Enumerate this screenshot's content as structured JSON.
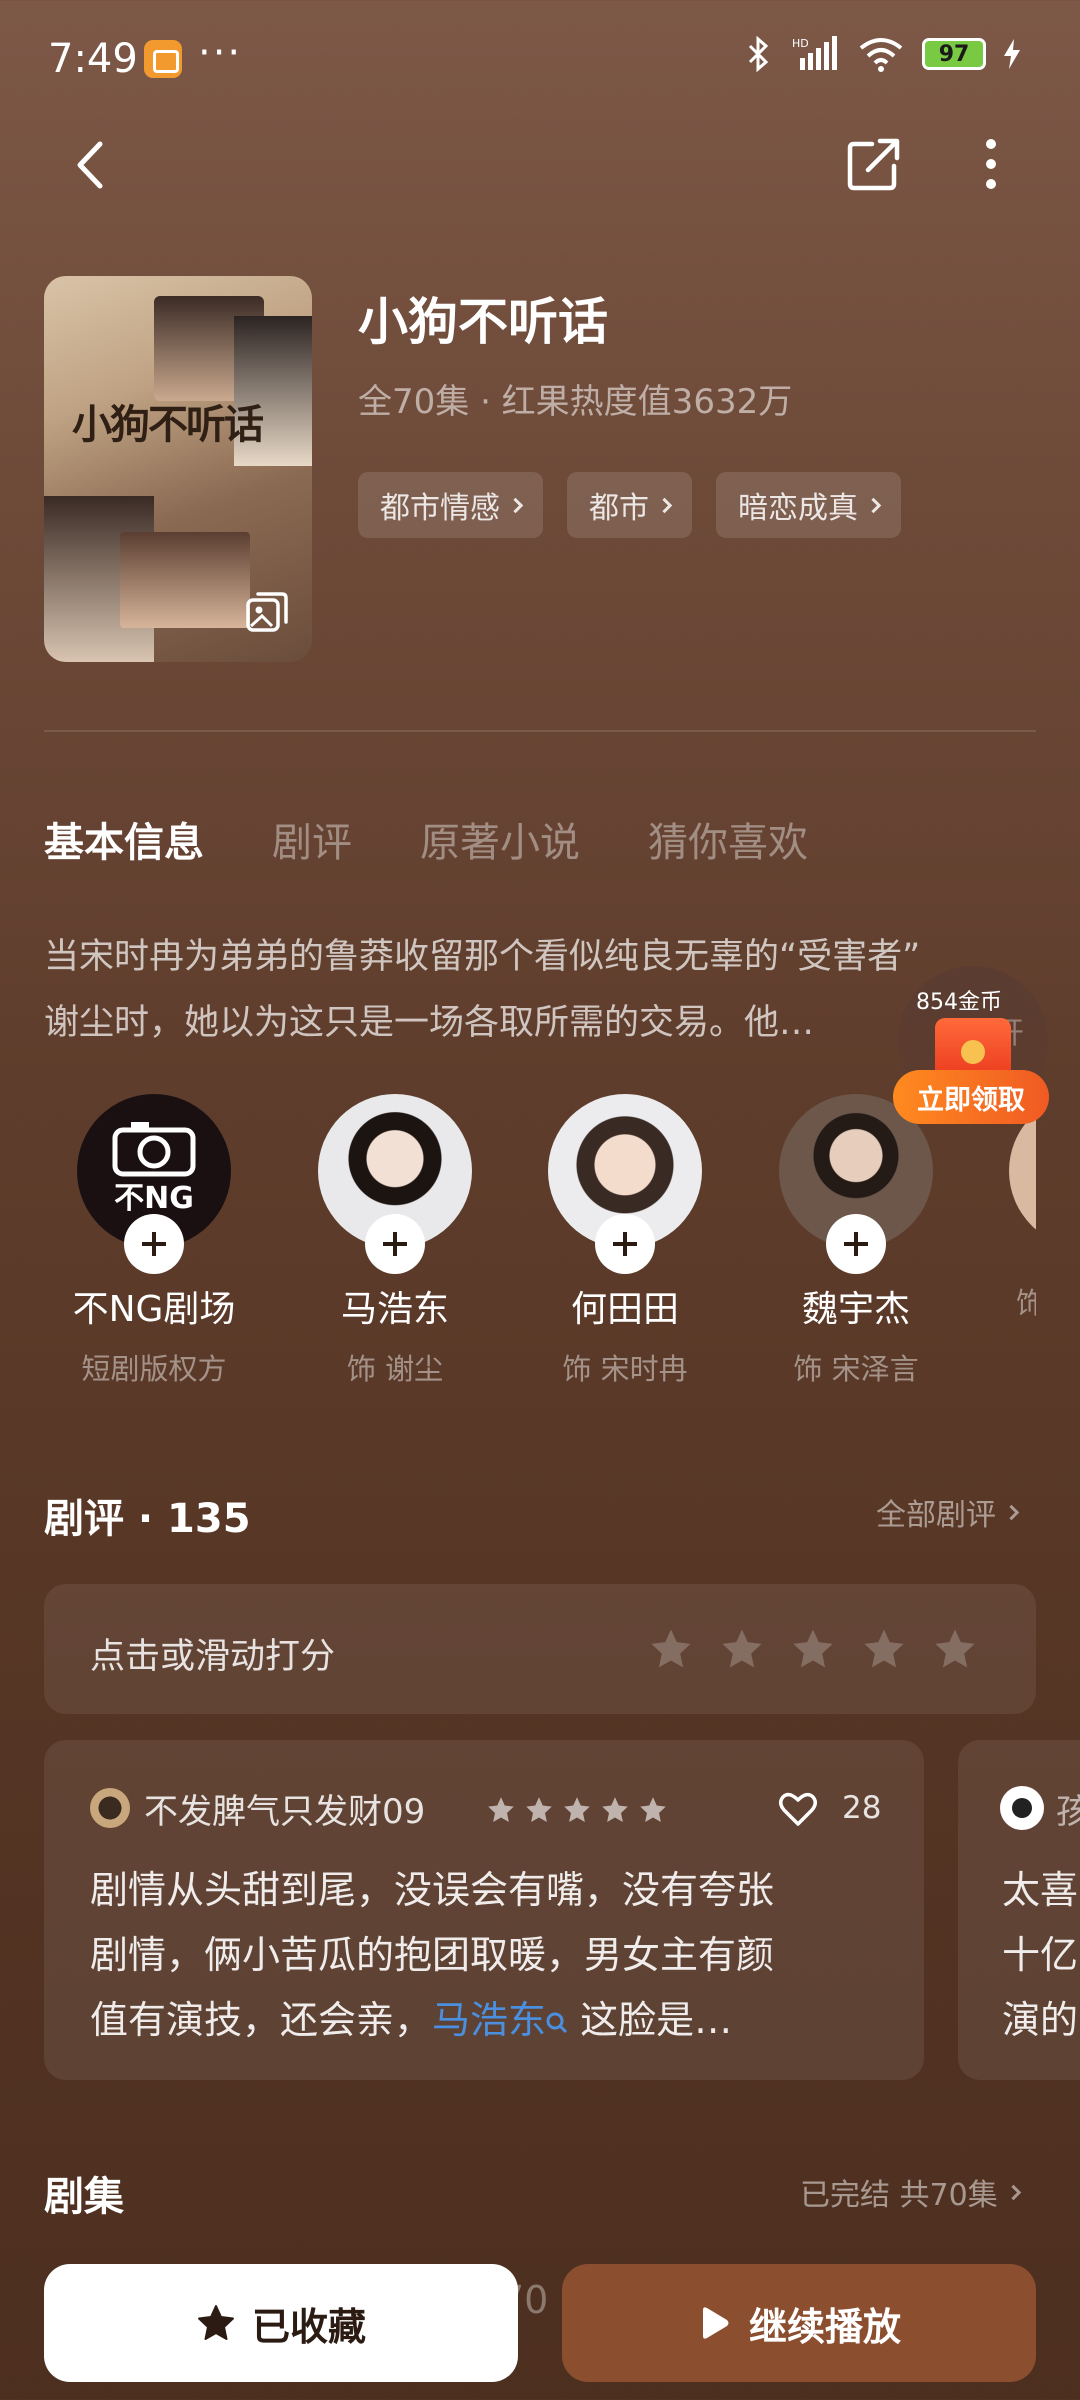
{
  "status_bar": {
    "time": "7:49",
    "more": "···",
    "network": "HD",
    "battery": "97"
  },
  "drama": {
    "poster_title": "小狗不听话",
    "title": "小狗不听话",
    "meta": "全70集 · 红果热度值3632万",
    "tags": [
      "都市情感",
      "都市",
      "暗恋成真"
    ]
  },
  "tabs": [
    "基本信息",
    "剧评",
    "原著小说",
    "猜你喜欢"
  ],
  "synopsis": {
    "line1": "当宋时冉为弟弟的鲁莽收留那个看似纯良无辜的“受害者”",
    "line2": "谢尘时，她以为这只是一场各取所需的交易。他…"
  },
  "reward": {
    "coins": "854金币",
    "open": "展开",
    "button": "立即领取"
  },
  "cast": [
    {
      "name": "不NG剧场",
      "role": "短剧版权方",
      "logo_text": "不NG"
    },
    {
      "name": "马浩东",
      "role": "饰 谢尘"
    },
    {
      "name": "何田田",
      "role": "饰 宋时冉"
    },
    {
      "name": "魏宇杰",
      "role": "饰 宋泽言"
    },
    {
      "name": "",
      "role": "饰"
    }
  ],
  "reviews": {
    "title": "剧评 · 135",
    "all_label": "全部剧评",
    "rate_prompt": "点击或滑动打分",
    "rating_scale": 5,
    "items": [
      {
        "user": "不发脾气只发财09",
        "stars": 5,
        "likes": "28",
        "line1": "剧情从头甜到尾，没误会有嘴，没有夸张",
        "line2": "剧情，俩小苦瓜的抱团取暖，男女主有颜",
        "line3_before": "值有演技，还会亲，",
        "line3_link": "马浩东",
        "line3_after": " 这脸是…"
      },
      {
        "user": "孩",
        "line1": "太喜",
        "line2": "十亿",
        "line3": "演的"
      }
    ]
  },
  "episodes": {
    "title": "剧集",
    "status": "已完结 共70集",
    "peek": "70"
  },
  "bottom": {
    "favorite_label": "已收藏",
    "play_label": "继续播放"
  },
  "colors": {
    "accent": "#8b4e2f",
    "link": "#4b8fe0",
    "reward": "#f05a23"
  }
}
